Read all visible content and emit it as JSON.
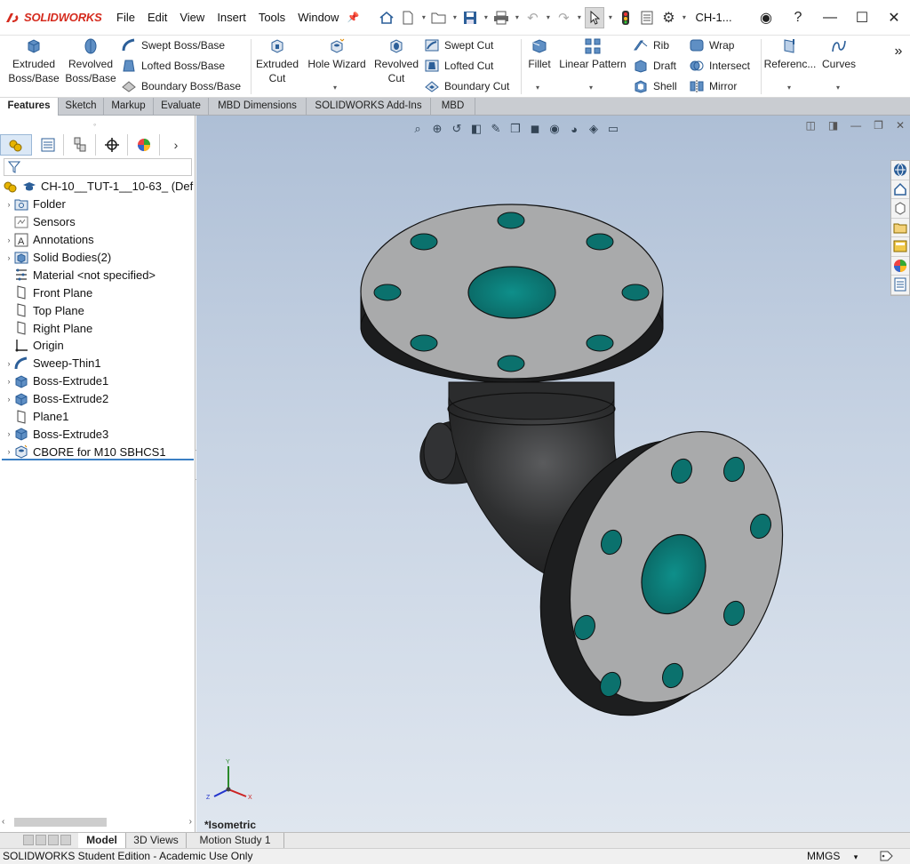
{
  "app": {
    "brand": "SOLIDWORKS",
    "document_title": "CH-1..."
  },
  "menu": [
    "File",
    "Edit",
    "View",
    "Insert",
    "Tools",
    "Window"
  ],
  "ribbon": {
    "extruded_boss": "Extruded Boss/Base",
    "revolved_boss": "Revolved Boss/Base",
    "swept_boss": "Swept Boss/Base",
    "lofted_boss": "Lofted Boss/Base",
    "boundary_boss": "Boundary Boss/Base",
    "extruded_cut": "Extruded Cut",
    "hole_wizard": "Hole Wizard",
    "revolved_cut": "Revolved Cut",
    "swept_cut": "Swept Cut",
    "lofted_cut": "Lofted Cut",
    "boundary_cut": "Boundary Cut",
    "fillet": "Fillet",
    "linear_pattern": "Linear Pattern",
    "rib": "Rib",
    "draft": "Draft",
    "shell": "Shell",
    "wrap": "Wrap",
    "intersect": "Intersect",
    "mirror": "Mirror",
    "reference": "Referenc...",
    "curves": "Curves",
    "more": "»"
  },
  "tabs": [
    "Features",
    "Sketch",
    "Markup",
    "Evaluate",
    "MBD Dimensions",
    "SOLIDWORKS Add-Ins",
    "MBD"
  ],
  "tree": {
    "root": "CH-10__TUT-1__10-63_ (Def",
    "items": [
      {
        "label": "Folder",
        "expandable": true,
        "icon": "folder-icon"
      },
      {
        "label": "Sensors",
        "expandable": false,
        "icon": "sensor-icon"
      },
      {
        "label": "Annotations",
        "expandable": true,
        "icon": "annotation-icon"
      },
      {
        "label": "Solid Bodies(2)",
        "expandable": true,
        "icon": "solid-bodies-icon"
      },
      {
        "label": "Material <not specified>",
        "expandable": false,
        "icon": "material-icon"
      },
      {
        "label": "Front Plane",
        "expandable": false,
        "icon": "plane-icon"
      },
      {
        "label": "Top Plane",
        "expandable": false,
        "icon": "plane-icon"
      },
      {
        "label": "Right Plane",
        "expandable": false,
        "icon": "plane-icon"
      },
      {
        "label": "Origin",
        "expandable": false,
        "icon": "origin-icon"
      },
      {
        "label": "Sweep-Thin1",
        "expandable": true,
        "icon": "sweep-icon"
      },
      {
        "label": "Boss-Extrude1",
        "expandable": true,
        "icon": "extrude-icon"
      },
      {
        "label": "Boss-Extrude2",
        "expandable": true,
        "icon": "extrude-icon"
      },
      {
        "label": "Plane1",
        "expandable": false,
        "icon": "plane-icon"
      },
      {
        "label": "Boss-Extrude3",
        "expandable": true,
        "icon": "extrude-icon"
      },
      {
        "label": "CBORE for M10 SBHCS1",
        "expandable": true,
        "icon": "hole-icon"
      }
    ]
  },
  "viewport": {
    "view_name": "*Isometric",
    "triad": {
      "x": "X",
      "y": "Y",
      "z": "Z"
    }
  },
  "bottom_tabs": [
    "Model",
    "3D Views",
    "Motion Study 1"
  ],
  "status": {
    "text": "SOLIDWORKS Student Edition - Academic Use Only",
    "units": "MMGS",
    "units_arrow": "▾"
  },
  "colors": {
    "accent": "#3b7fc4",
    "brand_red": "#d52b1e",
    "hole_teal": "#0f8a86",
    "flange_face": "#a9aaab",
    "body_dark": "#2a2b2c"
  }
}
